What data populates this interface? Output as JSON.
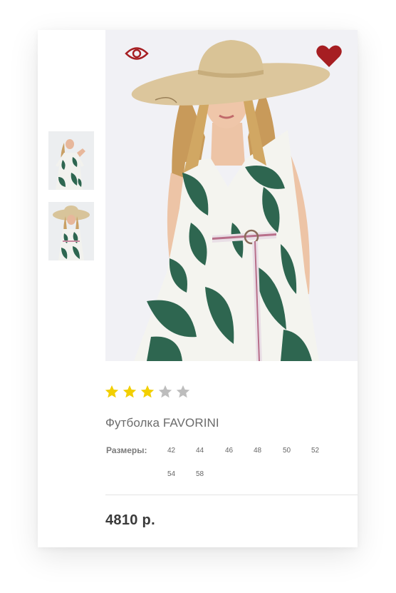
{
  "product": {
    "title": "Футболка FAVORINI",
    "price": "4810 р.",
    "rating": {
      "value": 3,
      "max": 5
    },
    "sizes_label": "Размеры:",
    "sizes": [
      "42",
      "44",
      "46",
      "48",
      "50",
      "52",
      "54",
      "58"
    ],
    "thumbnails": [
      {
        "icon": "thumbnail-model-dress-photo"
      },
      {
        "icon": "thumbnail-model-hat-photo"
      }
    ],
    "main_image": {
      "icon": "model-in-palm-print-dress-and-sun-hat-photo"
    }
  },
  "actions": {
    "quick_view_icon": "eye-icon",
    "favorite_icon": "heart-icon"
  },
  "colors": {
    "accent_red": "#a61e22",
    "star_active": "#f2cf00",
    "star_inactive": "#bdbdbd",
    "dress_green": "#2e6650"
  }
}
